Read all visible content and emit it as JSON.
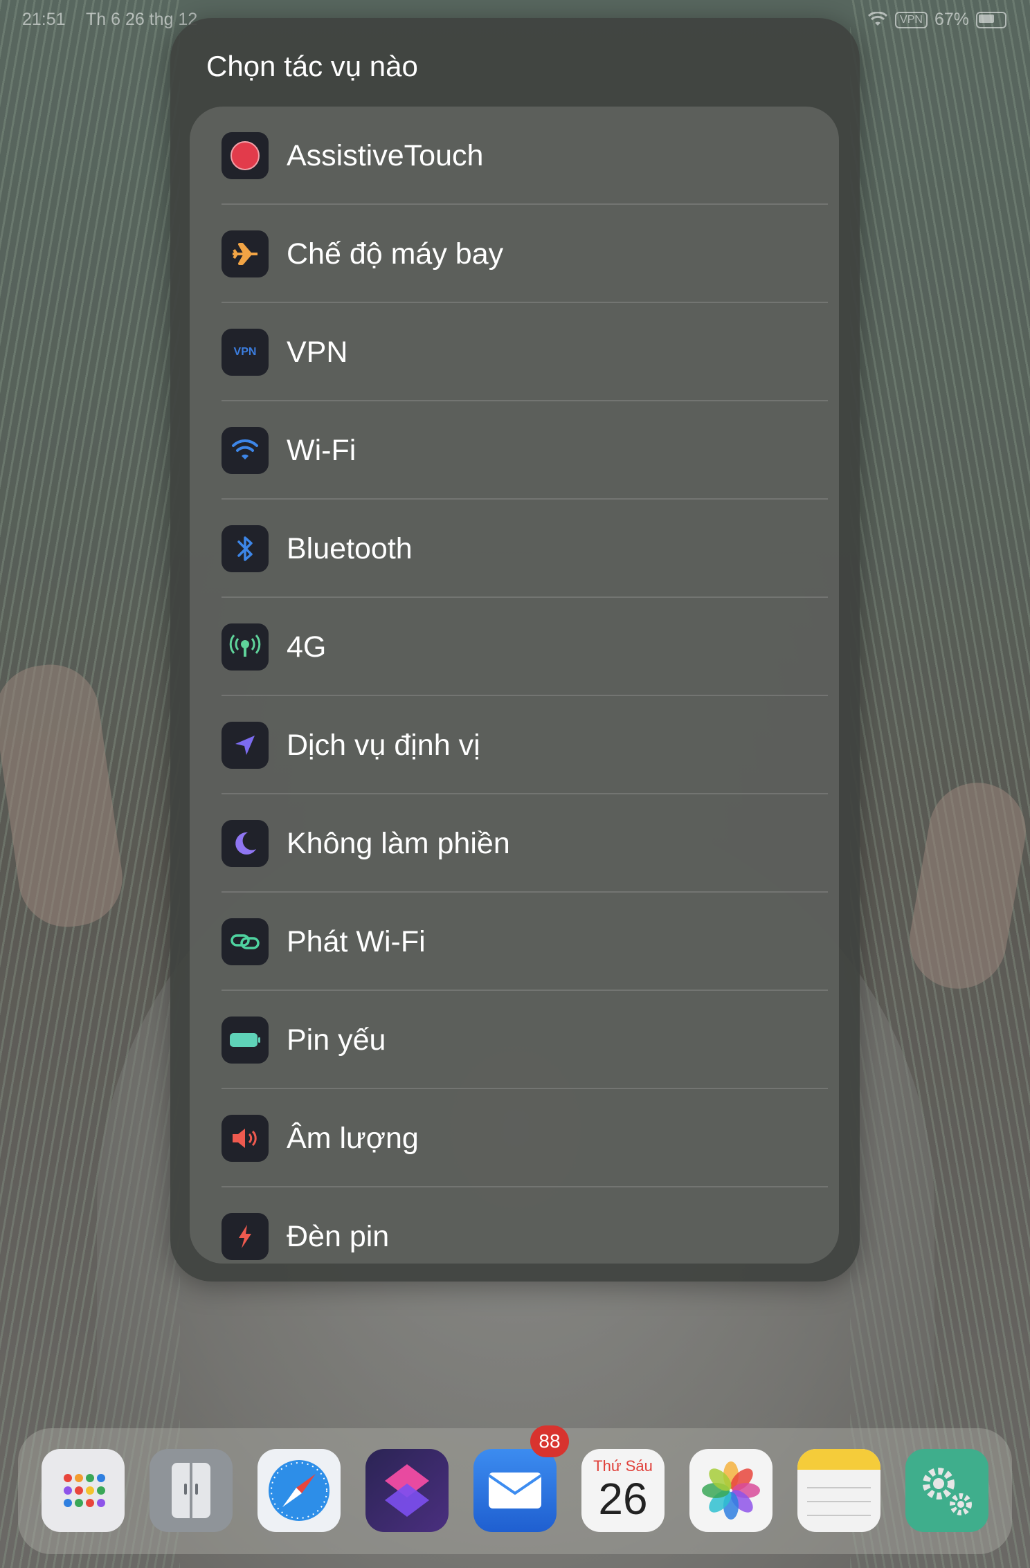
{
  "status_bar": {
    "time": "21:51",
    "date": "Th 6 26 thg 12",
    "vpn": "VPN",
    "battery": "67%"
  },
  "modal": {
    "title": "Chọn tác vụ nào",
    "items": [
      {
        "label": "AssistiveTouch",
        "icon": "assistive-touch-icon",
        "color": "#e23b4b"
      },
      {
        "label": "Chế độ máy bay",
        "icon": "airplane-icon",
        "color": "#f2a445"
      },
      {
        "label": "VPN",
        "icon": "vpn-icon",
        "icon_text": "VPN",
        "color": "#3c7ee0"
      },
      {
        "label": "Wi-Fi",
        "icon": "wifi-icon",
        "color": "#3d86e8"
      },
      {
        "label": "Bluetooth",
        "icon": "bluetooth-icon",
        "color": "#3d86e8"
      },
      {
        "label": "4G",
        "icon": "cellular-icon",
        "color": "#5fd39a"
      },
      {
        "label": "Dịch vụ định vị",
        "icon": "location-icon",
        "color": "#7c6cf0"
      },
      {
        "label": "Không làm phiền",
        "icon": "moon-icon",
        "color": "#8f76f2"
      },
      {
        "label": "Phát Wi-Fi",
        "icon": "hotspot-icon",
        "color": "#4fd3a0"
      },
      {
        "label": "Pin yếu",
        "icon": "battery-icon",
        "color": "#5fd3b8"
      },
      {
        "label": "Âm lượng",
        "icon": "volume-icon",
        "color": "#ef5a4f"
      },
      {
        "label": "Đèn pin",
        "icon": "flashlight-icon",
        "color": "#ef5a4f"
      }
    ]
  },
  "dock": {
    "apps": [
      {
        "name": "app-library",
        "icon": "app-grid-icon"
      },
      {
        "name": "files-cabinet",
        "icon": "cabinet-icon"
      },
      {
        "name": "safari",
        "icon": "compass-icon"
      },
      {
        "name": "shortcuts",
        "icon": "shortcuts-icon"
      },
      {
        "name": "mail",
        "icon": "mail-icon",
        "badge": "88"
      },
      {
        "name": "calendar",
        "icon": "calendar-icon",
        "day_name": "Thứ Sáu",
        "day_number": "26"
      },
      {
        "name": "photos",
        "icon": "photos-icon"
      },
      {
        "name": "notes",
        "icon": "notes-icon"
      },
      {
        "name": "settings",
        "icon": "settings-icon"
      }
    ]
  }
}
